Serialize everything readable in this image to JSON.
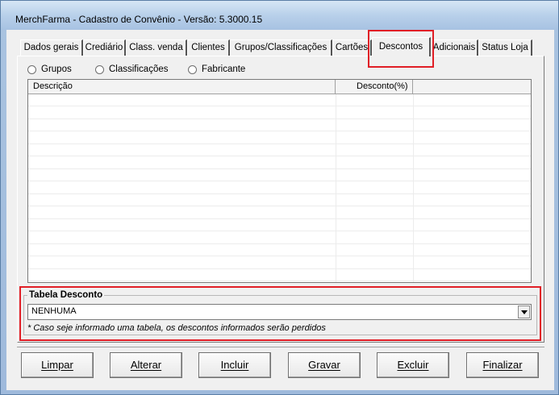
{
  "window": {
    "title": "MerchFarma - Cadastro de Convênio - Versão: 5.3000.15"
  },
  "tabs": [
    {
      "label": "Dados gerais",
      "active": false
    },
    {
      "label": "Crediário",
      "active": false
    },
    {
      "label": "Class. venda",
      "active": false
    },
    {
      "label": "Clientes",
      "active": false
    },
    {
      "label": "Grupos/Classificações",
      "active": false
    },
    {
      "label": "Cartões",
      "active": false
    },
    {
      "label": "Descontos",
      "active": true
    },
    {
      "label": "Adicionais",
      "active": false
    },
    {
      "label": "Status Loja",
      "active": false
    }
  ],
  "filter": {
    "options": [
      "Grupos",
      "Classificações",
      "Fabricante"
    ]
  },
  "grid": {
    "columns": [
      "Descrição",
      "Desconto(%)"
    ],
    "rows": []
  },
  "tabela_desconto": {
    "legend": "Tabela Desconto",
    "selected": "NENHUMA",
    "note": "* Caso seje informado uma tabela, os descontos informados serão perdidos"
  },
  "buttons": {
    "limpar": "Limpar",
    "alterar": "Alterar",
    "incluir": "Incluir",
    "gravar": "Gravar",
    "excluir": "Excluir",
    "finalizar": "Finalizar"
  },
  "colors": {
    "highlight": "#e01e26",
    "window_bg": "#f0f0f0"
  }
}
